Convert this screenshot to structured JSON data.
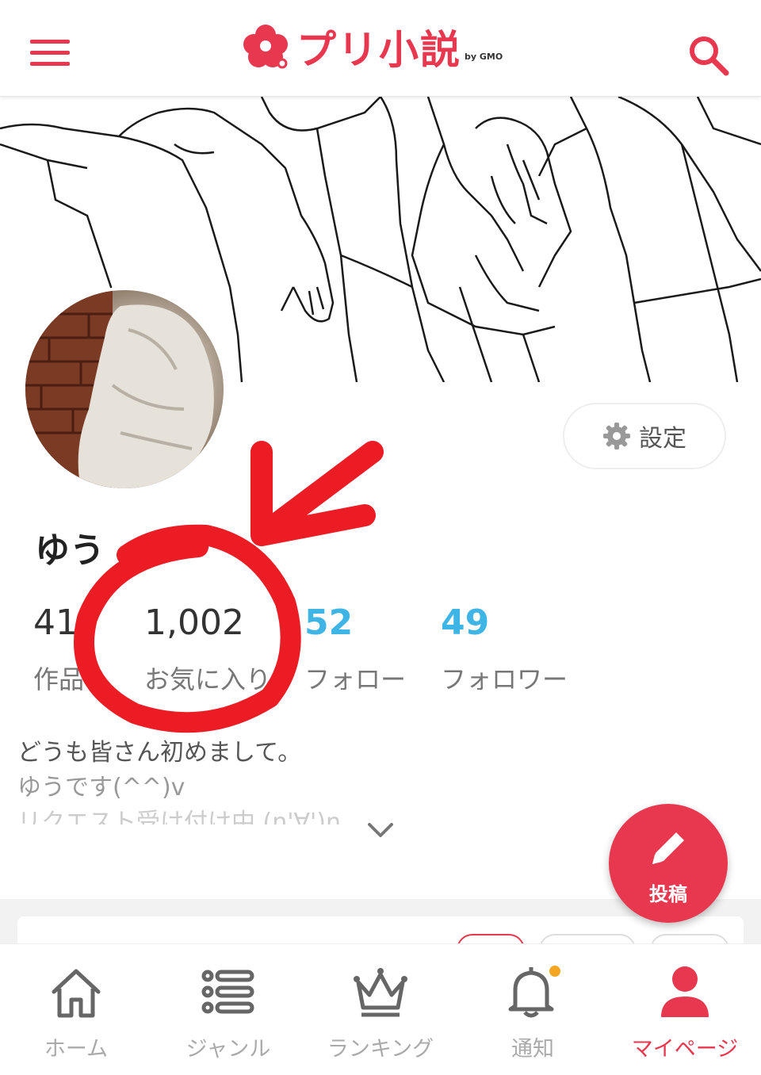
{
  "app": {
    "logo_text": "プリ小説",
    "logo_by": "by GMO",
    "brand_color": "#e8384f",
    "accent_blue": "#3fb5e5"
  },
  "header": {
    "menu_icon": "hamburger-menu-icon",
    "search_icon": "search-icon"
  },
  "profile": {
    "username": "ゆう",
    "settings_label": "設定",
    "stats": [
      {
        "value": "41",
        "label": "作品"
      },
      {
        "value": "1,002",
        "label": "お気に入り"
      },
      {
        "value": "52",
        "label": "フォロー"
      },
      {
        "value": "49",
        "label": "フォロワー"
      }
    ],
    "bio": [
      "どうも皆さん初めまして。",
      "ゆうです(^^)v",
      "リクエスト受け付け中 (n'∀')η"
    ]
  },
  "fab": {
    "label": "投稿"
  },
  "bottom_nav": [
    {
      "label": "ホーム",
      "icon": "home-icon"
    },
    {
      "label": "ジャンル",
      "icon": "list-icon"
    },
    {
      "label": "ランキング",
      "icon": "crown-icon"
    },
    {
      "label": "通知",
      "icon": "bell-icon"
    },
    {
      "label": "マイページ",
      "icon": "person-icon",
      "active": true
    }
  ]
}
